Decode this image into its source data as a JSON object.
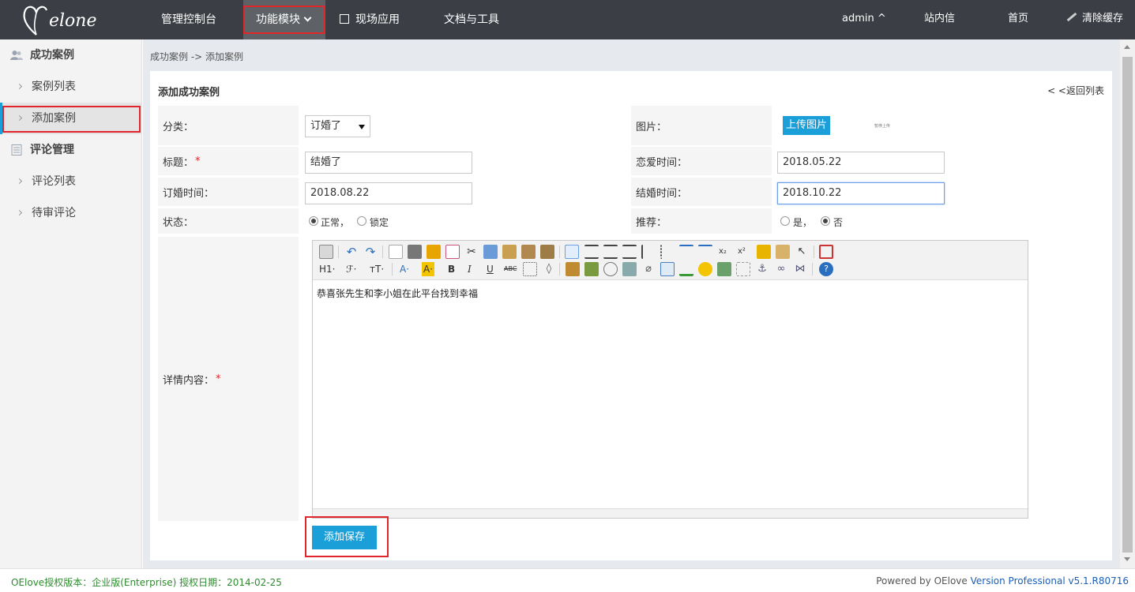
{
  "header": {
    "logo_text": "elone",
    "nav": [
      {
        "label": "管理控制台"
      },
      {
        "label": "功能模块"
      },
      {
        "label": "现场应用"
      },
      {
        "label": "文档与工具"
      }
    ],
    "user": "admin ^",
    "messages": "站内信",
    "home": "首页",
    "clear_cache": "清除缓存"
  },
  "sidebar": {
    "groups": [
      {
        "label": "成功案例",
        "items": [
          "案例列表",
          "添加案例"
        ]
      },
      {
        "label": "评论管理",
        "items": [
          "评论列表",
          "待审评论"
        ]
      }
    ],
    "active_item": "添加案例"
  },
  "breadcrumb": "成功案例 -> 添加案例",
  "panel": {
    "title": "添加成功案例",
    "back": "< <返回列表"
  },
  "form": {
    "category_label": "分类：",
    "category_value": "订婚了",
    "image_label": "图片：",
    "upload_button": "上传图片",
    "upload_hint": "暂停上传",
    "title_label": "标题：",
    "title_value": "结婚了",
    "love_time_label": "恋爱时间：",
    "love_time_value": "2018.05.22",
    "engage_time_label": "订婚时间：",
    "engage_time_value": "2018.08.22",
    "wedding_time_label": "结婚时间：",
    "wedding_time_value": "2018.10.22",
    "status_label": "状态：",
    "status_options": [
      "正常，",
      "锁定"
    ],
    "status_selected": "正常",
    "recommend_label": "推荐：",
    "recommend_options": [
      "是，",
      "否"
    ],
    "recommend_selected": "否",
    "content_label": "详情内容：",
    "content_value": "恭喜张先生和李小姐在此平台找到幸福",
    "toolbar_text": {
      "h1": "H1·",
      "font": "ℱ·",
      "size": "тT·",
      "color": "A·",
      "bg": "A·",
      "bold": "B",
      "italic": "I",
      "underline": "U",
      "strike": "ABC"
    },
    "save_button": "添加保存"
  },
  "footer": {
    "license": "OElove授权版本：企业版(Enterprise) 授权日期：2014-02-25",
    "powered_prefix": "Powered by OElove",
    "powered_version": "Version Professional v5.1.R80716"
  },
  "colors": {
    "accent": "#1b9fd8",
    "topbar": "#3b3f45",
    "highlight": "#e0262b"
  }
}
